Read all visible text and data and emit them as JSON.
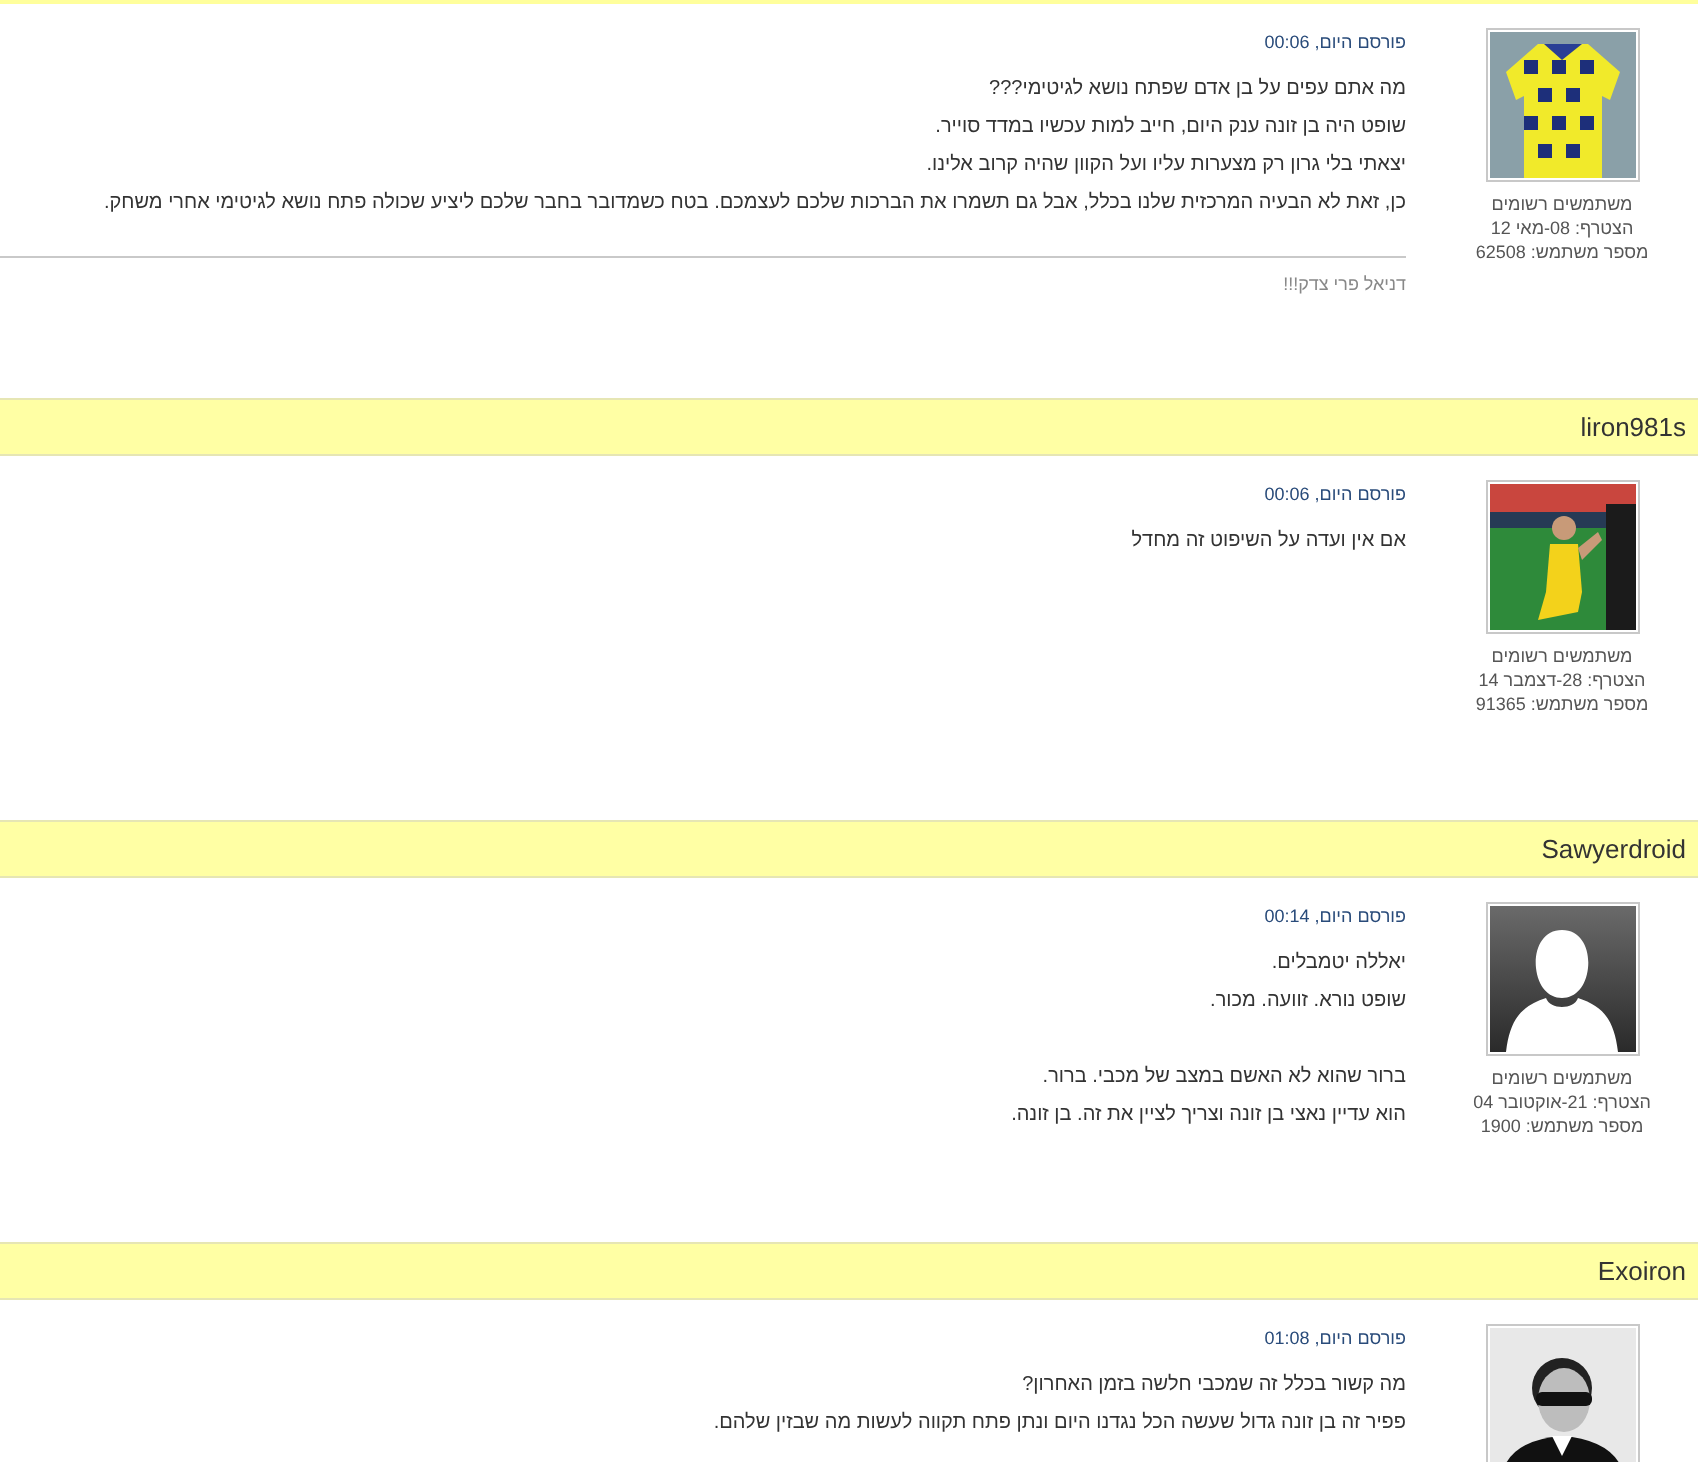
{
  "posts": [
    {
      "posted": "פורסם היום, 00:06",
      "avatar": {
        "kind": "picture"
      },
      "user_group": "משתמשים רשומים",
      "joined": "הצטרף: 08-מאי 12",
      "user_number": "מספר משתמש: 62508",
      "paragraphs": [
        [
          "מה אתם עפים על בן אדם שפתח נושא לגיטימי???",
          "שופט היה בן זונה ענק היום, חייב למות עכשיו במדד סוייר.",
          "יצאתי בלי גרון רק מצערות עליו ועל הקוון שהיה קרוב אלינו.",
          "כן, זאת לא הבעיה המרכזית שלנו בכלל, אבל גם תשמרו את הברכות שלכם לעצמכם. בטח כשמדובר בחבר שלכם ליציע שכולה פתח נושא לגיטימי אחרי משחק."
        ]
      ],
      "signature": "דניאל פרי צדק!!!"
    },
    {
      "username": "liron981s",
      "posted": "פורסם היום, 00:06",
      "avatar": {
        "kind": "picture"
      },
      "user_group": "משתמשים רשומים",
      "joined": "הצטרף: 28-דצמבר 14",
      "user_number": "מספר משתמש: 91365",
      "paragraphs": [
        [
          "אם אין ועדה על השיפוט זה מחדל"
        ]
      ]
    },
    {
      "username": "Sawyerdroid",
      "posted": "פורסם היום, 00:14",
      "avatar": {
        "kind": "silhouette"
      },
      "user_group": "משתמשים רשומים",
      "joined": "הצטרף: 21-אוקטובר 04",
      "user_number": "מספר משתמש: 1900",
      "paragraphs": [
        [
          "יאללה יטמבלים.",
          "שופט נורא. זוועה. מכור."
        ],
        [
          "ברור שהוא לא האשם במצב של מכבי. ברור.",
          "הוא עדיין נאצי בן זונה וצריך לציין את זה. בן זונה."
        ]
      ]
    },
    {
      "username": "Exoiron",
      "posted": "פורסם היום, 01:08",
      "avatar": {
        "kind": "picture"
      },
      "paragraphs": [
        [
          "מה קשור בכלל זה שמכבי חלשה בזמן האחרון?",
          "פפיר זה בן זונה גדול שעשה הכל נגדנו היום ונתן פתח תקווה לעשות מה שבזין שלהם."
        ]
      ]
    }
  ]
}
